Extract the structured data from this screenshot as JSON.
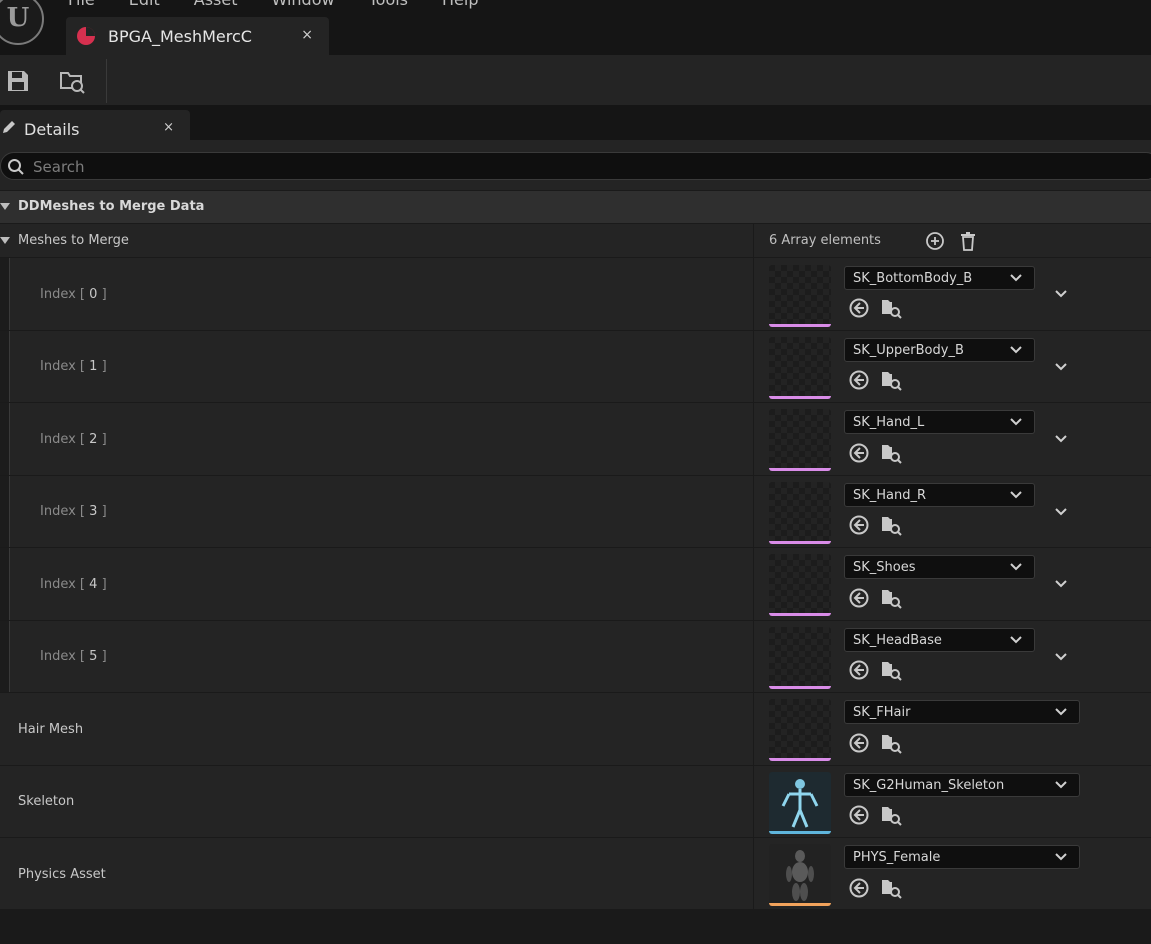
{
  "menu": [
    "File",
    "Edit",
    "Asset",
    "Window",
    "Tools",
    "Help"
  ],
  "tab": {
    "title": "BPGA_MeshMercC",
    "close": "×"
  },
  "details_tab": {
    "label": "Details",
    "close": "×"
  },
  "search": {
    "placeholder": "Search"
  },
  "category": {
    "label": "DDMeshes to Merge Data"
  },
  "array": {
    "label": "Meshes to Merge",
    "count": "6 Array elements"
  },
  "elements": [
    {
      "index_prefix": "Index [",
      "index": "0",
      "index_suffix": "]",
      "value": "SK_BottomBody_B",
      "strip": "#d98ce8"
    },
    {
      "index_prefix": "Index [",
      "index": "1",
      "index_suffix": "]",
      "value": "SK_UpperBody_B",
      "strip": "#d98ce8"
    },
    {
      "index_prefix": "Index [",
      "index": "2",
      "index_suffix": "]",
      "value": "SK_Hand_L",
      "strip": "#d98ce8"
    },
    {
      "index_prefix": "Index [",
      "index": "3",
      "index_suffix": "]",
      "value": "SK_Hand_R",
      "strip": "#d98ce8"
    },
    {
      "index_prefix": "Index [",
      "index": "4",
      "index_suffix": "]",
      "value": "SK_Shoes",
      "strip": "#d98ce8"
    },
    {
      "index_prefix": "Index [",
      "index": "5",
      "index_suffix": "]",
      "value": "SK_HeadBase",
      "strip": "#d98ce8"
    }
  ],
  "properties": [
    {
      "label": "Hair Mesh",
      "value": "SK_FHair",
      "strip": "#d98ce8"
    },
    {
      "label": "Skeleton",
      "value": "SK_G2Human_Skeleton",
      "strip": "#5fb5dc"
    },
    {
      "label": "Physics Asset",
      "value": "PHYS_Female",
      "strip": "#f2a35c"
    }
  ],
  "colors": {
    "accent_blueprint": "#d6304f",
    "mesh_strip": "#d98ce8",
    "skeleton_strip": "#5fb5dc",
    "physics_strip": "#f2a35c"
  }
}
